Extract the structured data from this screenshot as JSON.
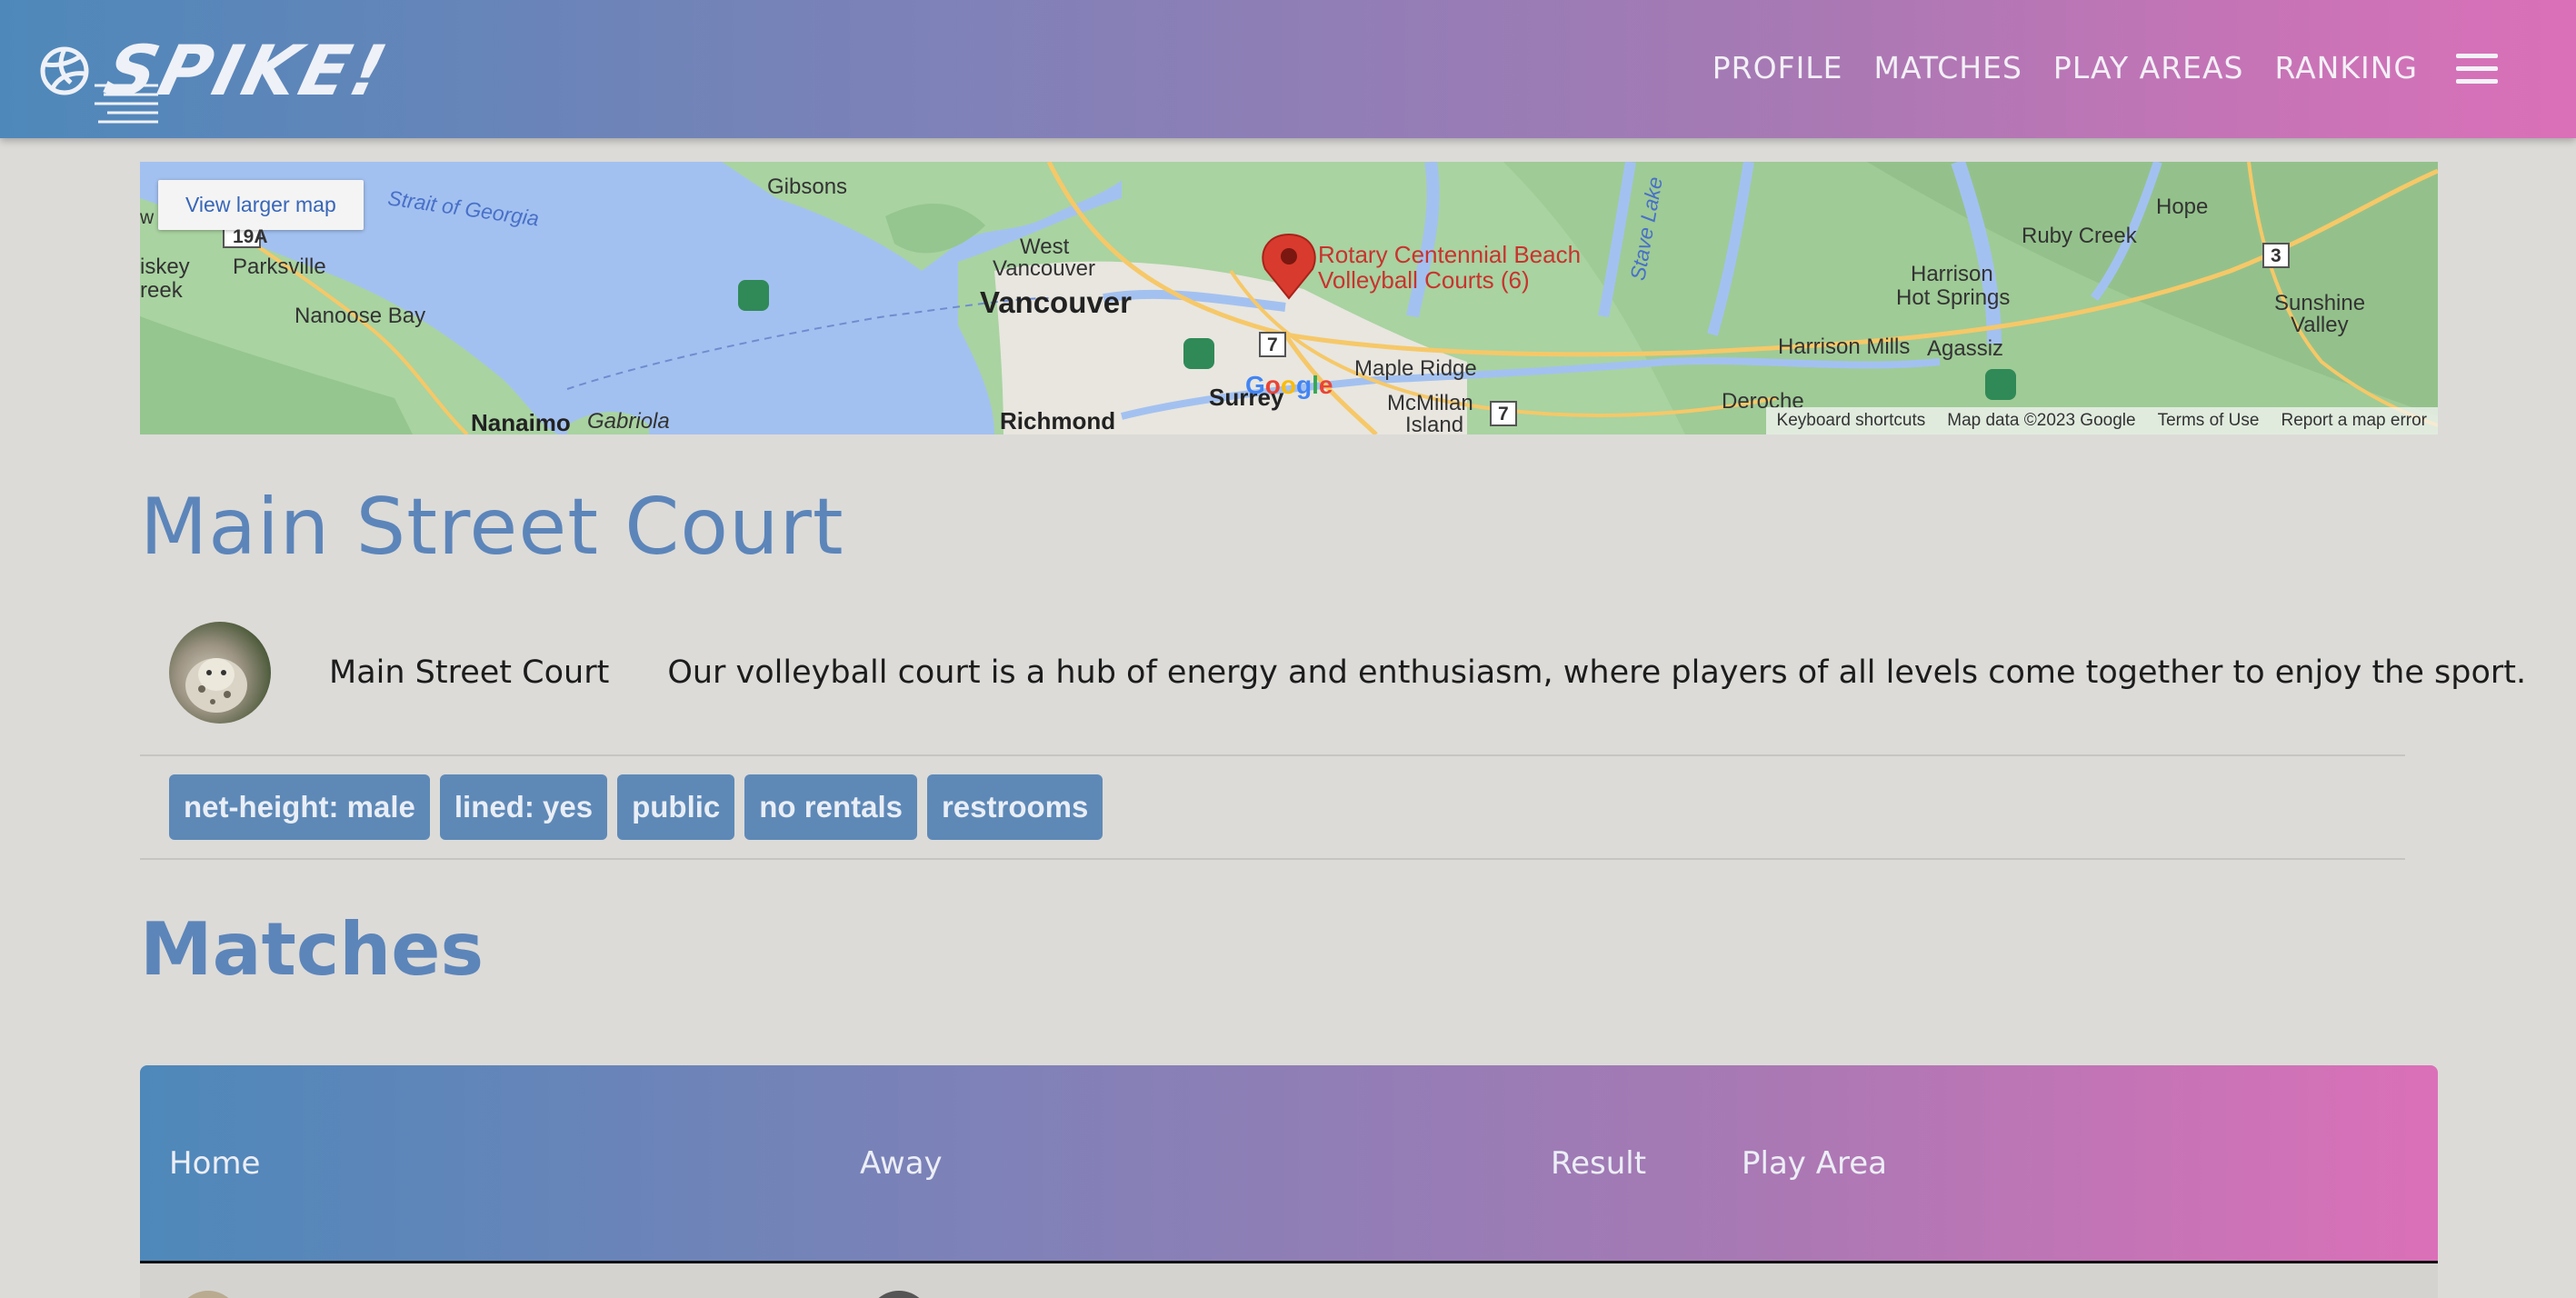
{
  "app": {
    "brand": "SPIKE!",
    "nav": [
      "PROFILE",
      "MATCHES",
      "PLAY AREAS",
      "RANKING"
    ],
    "menu_icon": "hamburger-icon",
    "gradient": [
      "#4e88ba",
      "#a879b4",
      "#db70b8"
    ]
  },
  "map": {
    "view_larger": "View larger map",
    "labels": {
      "strait": "Strait of Georgia",
      "gibsons": "Gibsons",
      "parksville": "Parksville",
      "iskey": "iskey",
      "reek": "reek",
      "nanoose": "Nanoose Bay",
      "nanaimo": "Nanaimo",
      "gabriola": "Gabriola",
      "west_vancouver_1": "West",
      "west_vancouver_2": "Vancouver",
      "vancouver": "Vancouver",
      "richmond": "Richmond",
      "surrey": "Surrey",
      "maple_ridge": "Maple Ridge",
      "mcmillan_1": "McMillan",
      "mcmillan_2": "Island",
      "stave_lake": "Stave Lake",
      "harrison_hs_1": "Harrison",
      "harrison_hs_2": "Hot Springs",
      "harrison_mills": "Harrison Mills",
      "agassiz": "Agassiz",
      "deroche": "Deroche",
      "hope": "Hope",
      "ruby_creek": "Ruby Creek",
      "sunshine_1": "Sunshine",
      "sunshine_2": "Valley",
      "hw_19a": "19A",
      "hw_7": "7",
      "hw_3": "3",
      "w": "w"
    },
    "pin": {
      "line1": "Rotary Centennial Beach",
      "line2": "Volleyball Courts (6)"
    },
    "google": "Google",
    "footer": [
      "Keyboard shortcuts",
      "Map data ©2023 Google",
      "Terms of Use",
      "Report a map error"
    ]
  },
  "court": {
    "title": "Main Street Court",
    "name": "Main Street Court",
    "description": "Our volleyball court is a hub of energy and enthusiasm, where players of all levels come together to enjoy the sport.",
    "tags": [
      "net-height: male",
      "lined: yes",
      "public",
      "no rentals",
      "restrooms"
    ]
  },
  "matches": {
    "title": "Matches",
    "columns": [
      "Home",
      "Away",
      "Result",
      "Play Area"
    ]
  }
}
